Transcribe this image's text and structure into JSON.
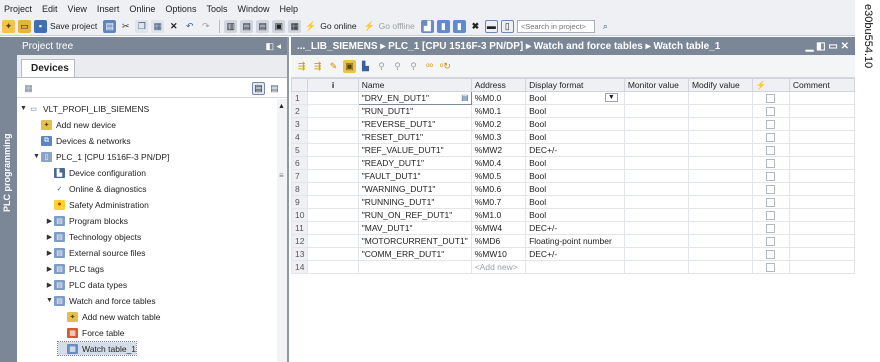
{
  "menu": [
    "Project",
    "Edit",
    "View",
    "Insert",
    "Online",
    "Options",
    "Tools",
    "Window",
    "Help"
  ],
  "toolbar": {
    "save_project": "Save project",
    "go_online": "Go online",
    "go_offline": "Go offline",
    "search_placeholder": "<Search in project>"
  },
  "side_tab": "PLC programming",
  "project_tree": {
    "title": "Project tree",
    "tab": "Devices",
    "items": [
      {
        "label": "VLT_PROFI_LIB_SIEMENS",
        "indent": 0,
        "twisty": "▼",
        "icon": "project-icon"
      },
      {
        "label": "Add new device",
        "indent": 1,
        "twisty": "",
        "icon": "add-device-icon"
      },
      {
        "label": "Devices & networks",
        "indent": 1,
        "twisty": "",
        "icon": "network-icon"
      },
      {
        "label": "PLC_1 [CPU 1516F-3 PN/DP]",
        "indent": 1,
        "twisty": "▼",
        "icon": "plc-icon"
      },
      {
        "label": "Device configuration",
        "indent": 2,
        "twisty": "",
        "icon": "device-config-icon"
      },
      {
        "label": "Online & diagnostics",
        "indent": 2,
        "twisty": "",
        "icon": "diagnostics-icon"
      },
      {
        "label": "Safety Administration",
        "indent": 2,
        "twisty": "",
        "icon": "safety-icon"
      },
      {
        "label": "Program blocks",
        "indent": 2,
        "twisty": "▶",
        "icon": "folder-icon"
      },
      {
        "label": "Technology objects",
        "indent": 2,
        "twisty": "▶",
        "icon": "folder-icon"
      },
      {
        "label": "External source files",
        "indent": 2,
        "twisty": "▶",
        "icon": "folder-icon"
      },
      {
        "label": "PLC tags",
        "indent": 2,
        "twisty": "▶",
        "icon": "folder-icon"
      },
      {
        "label": "PLC data types",
        "indent": 2,
        "twisty": "▶",
        "icon": "folder-icon"
      },
      {
        "label": "Watch and force tables",
        "indent": 2,
        "twisty": "▼",
        "icon": "folder-icon"
      },
      {
        "label": "Add new watch table",
        "indent": 3,
        "twisty": "",
        "icon": "add-table-icon"
      },
      {
        "label": "Force table",
        "indent": 3,
        "twisty": "",
        "icon": "force-table-icon"
      },
      {
        "label": "Watch table_1",
        "indent": 3,
        "twisty": "",
        "icon": "watch-table-icon"
      }
    ]
  },
  "editor": {
    "breadcrumb": "..._LIB_SIEMENS ▸ PLC_1 [CPU 1516F-3 PN/DP] ▸ Watch and force tables ▸ Watch table_1",
    "columns": [
      "i",
      "Name",
      "Address",
      "Display format",
      "Monitor value",
      "Modify value",
      "",
      "Comment"
    ],
    "rows": [
      {
        "n": "1",
        "name": "\"DRV_EN_DUT1\"",
        "address": "%M0.0",
        "format": "Bool"
      },
      {
        "n": "2",
        "name": "\"RUN_DUT1\"",
        "address": "%M0.1",
        "format": "Bool"
      },
      {
        "n": "3",
        "name": "\"REVERSE_DUT1\"",
        "address": "%M0.2",
        "format": "Bool"
      },
      {
        "n": "4",
        "name": "\"RESET_DUT1\"",
        "address": "%M0.3",
        "format": "Bool"
      },
      {
        "n": "5",
        "name": "\"REF_VALUE_DUT1\"",
        "address": "%MW2",
        "format": "DEC+/-"
      },
      {
        "n": "6",
        "name": "\"READY_DUT1\"",
        "address": "%M0.4",
        "format": "Bool"
      },
      {
        "n": "7",
        "name": "\"FAULT_DUT1\"",
        "address": "%M0.5",
        "format": "Bool"
      },
      {
        "n": "8",
        "name": "\"WARNING_DUT1\"",
        "address": "%M0.6",
        "format": "Bool"
      },
      {
        "n": "9",
        "name": "\"RUNNING_DUT1\"",
        "address": "%M0.7",
        "format": "Bool"
      },
      {
        "n": "10",
        "name": "\"RUN_ON_REF_DUT1\"",
        "address": "%M1.0",
        "format": "Bool"
      },
      {
        "n": "11",
        "name": "\"MAV_DUT1\"",
        "address": "%MW4",
        "format": "DEC+/-"
      },
      {
        "n": "12",
        "name": "\"MOTORCURRENT_DUT1\"",
        "address": "%MD6",
        "format": "Floating-point number"
      },
      {
        "n": "13",
        "name": "\"COMM_ERR_DUT1\"",
        "address": "%MW10",
        "format": "DEC+/-"
      },
      {
        "n": "14",
        "name": "",
        "address": "<Add new>",
        "format": ""
      }
    ]
  },
  "figure_code": "e30bu554.10"
}
